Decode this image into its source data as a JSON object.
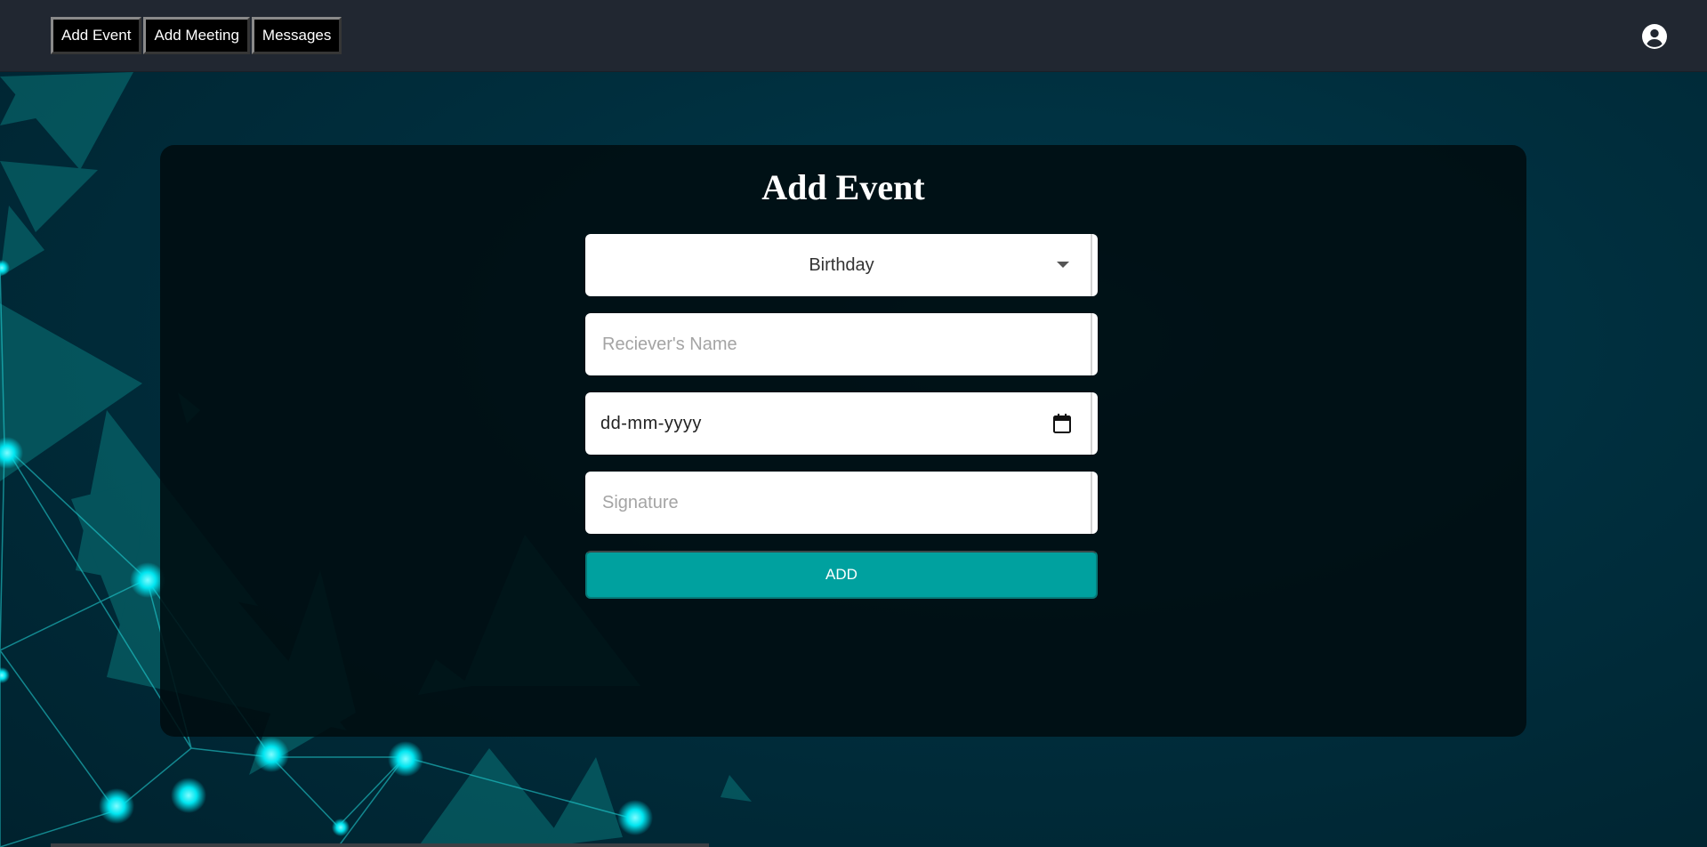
{
  "nav": {
    "items": [
      "Add Event",
      "Add Meeting",
      "Messages"
    ]
  },
  "header": {
    "user_icon": "account-circle-icon"
  },
  "form": {
    "title": "Add Event",
    "event_type": {
      "selected": "Birthday",
      "icon": "chevron-down-icon"
    },
    "receiver_name": {
      "value": "",
      "placeholder": "Reciever's Name"
    },
    "date": {
      "placeholder": "dd-mm-yyyy",
      "icon": "calendar-icon"
    },
    "signature": {
      "value": "",
      "placeholder": "Signature"
    },
    "submit_label": "ADD"
  },
  "colors": {
    "topbar": "#212731",
    "accent": "#00a19f",
    "background": "#002e3d",
    "card": "#000c10"
  }
}
